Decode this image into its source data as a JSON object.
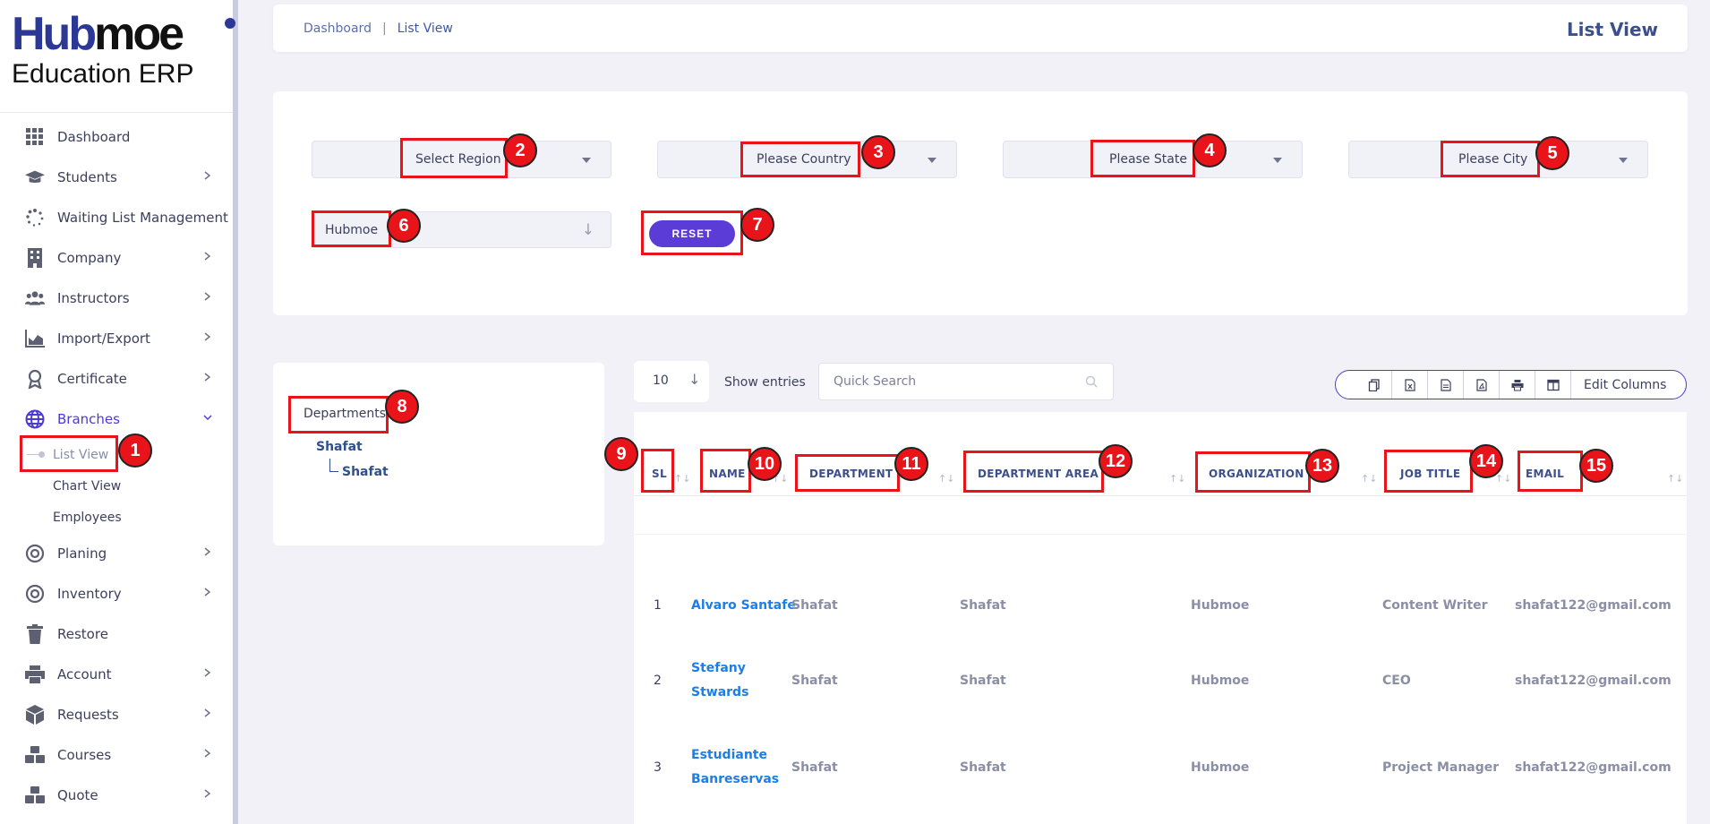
{
  "sidebar": {
    "logo": {
      "part1": "Hub",
      "part2": "moe",
      "subtitle": "Education ERP"
    },
    "items": [
      {
        "label": "Dashboard",
        "icon": "grid-icon"
      },
      {
        "label": "Students",
        "icon": "graduation-cap-icon"
      },
      {
        "label": "Waiting List Management",
        "icon": "spinner-icon"
      },
      {
        "label": "Company",
        "icon": "building-icon"
      },
      {
        "label": "Instructors",
        "icon": "users-icon"
      },
      {
        "label": "Import/Export",
        "icon": "chart-area-icon"
      },
      {
        "label": "Certificate",
        "icon": "award-icon"
      },
      {
        "label": "Branches",
        "icon": "globe-icon"
      },
      {
        "label": "Planing",
        "icon": "target-icon"
      },
      {
        "label": "Inventory",
        "icon": "target-icon"
      },
      {
        "label": "Restore",
        "icon": "trash-icon"
      },
      {
        "label": "Account",
        "icon": "printer-icon"
      },
      {
        "label": "Requests",
        "icon": "box-icon"
      },
      {
        "label": "Courses",
        "icon": "boxes-icon"
      },
      {
        "label": "Quote",
        "icon": "boxes-icon"
      }
    ],
    "branches_sub": [
      "List View",
      "Chart View",
      "Employees"
    ]
  },
  "header": {
    "breadcrumb_home": "Dashboard",
    "breadcrumb_sep": "|",
    "breadcrumb_current": "List View",
    "title": "List View"
  },
  "filters": {
    "region": "Select Region",
    "country": "Please Country",
    "state": "Please State",
    "city": "Please City",
    "organization": "Hubmoe",
    "reset_label": "RESET"
  },
  "departments": {
    "title": "Departments",
    "root": "Shafat",
    "child": "Shafat"
  },
  "table_tools": {
    "page_length": "10",
    "show_entries": "Show entries",
    "search_placeholder": "Quick Search",
    "edit_columns": "Edit Columns"
  },
  "table": {
    "columns": [
      "SL",
      "NAME",
      "DEPARTMENT",
      "DEPARTMENT AREA",
      "ORGANIZATION",
      "JOB TITLE",
      "EMAIL"
    ],
    "rows": [
      {
        "sl": "1",
        "name1": "Alvaro Santafe",
        "name2": "",
        "department": "Shafat",
        "area": "Shafat",
        "organization": "Hubmoe",
        "job": "Content Writer",
        "email": "shafat122@gmail.com"
      },
      {
        "sl": "2",
        "name1": "Stefany",
        "name2": "Stwards",
        "department": "Shafat",
        "area": "Shafat",
        "organization": "Hubmoe",
        "job": "CEO",
        "email": "shafat122@gmail.com"
      },
      {
        "sl": "3",
        "name1": "Estudiante",
        "name2": "Banreservas",
        "department": "Shafat",
        "area": "Shafat",
        "organization": "Hubmoe",
        "job": "Project Manager",
        "email": "shafat122@gmail.com"
      }
    ]
  },
  "annotations": [
    "1",
    "2",
    "3",
    "4",
    "5",
    "6",
    "7",
    "8",
    "9",
    "10",
    "11",
    "12",
    "13",
    "14",
    "15"
  ],
  "colors": {
    "accent": "#4b3bd1",
    "button": "#5b3cd6",
    "annotation": "#e8141a",
    "link": "#1c7ee6",
    "brand": "#2b3896"
  }
}
